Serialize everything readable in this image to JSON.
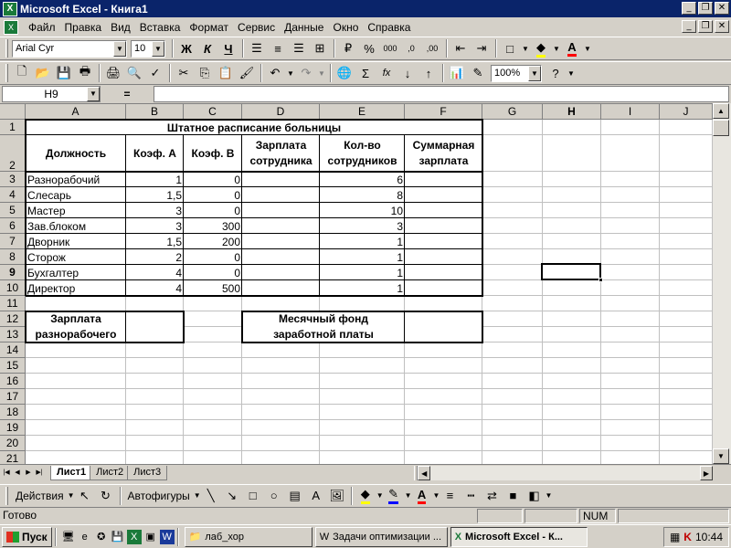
{
  "window": {
    "title": "Microsoft Excel - Книга1",
    "app_icon_letter": "X"
  },
  "menu": [
    "Файл",
    "Правка",
    "Вид",
    "Вставка",
    "Формат",
    "Сервис",
    "Данные",
    "Окно",
    "Справка"
  ],
  "format_toolbar": {
    "font": "Arial Cyr",
    "size": "10",
    "bold": "Ж",
    "italic": "К",
    "underline": "Ч",
    "percent": "%",
    "thousands": "000"
  },
  "standard_toolbar": {
    "zoom": "100%",
    "autosum": "Σ",
    "function": "fx"
  },
  "formula_bar": {
    "name_box": "H9",
    "equals": "="
  },
  "columns": [
    "A",
    "B",
    "C",
    "D",
    "E",
    "F",
    "G",
    "H",
    "I",
    "J"
  ],
  "selected_column": "H",
  "selected_row": "9",
  "rows": [
    "1",
    "2",
    "3",
    "4",
    "5",
    "6",
    "7",
    "8",
    "9",
    "10",
    "11",
    "12",
    "13",
    "14",
    "15",
    "16",
    "17",
    "18",
    "19",
    "20",
    "21"
  ],
  "sheet": {
    "title": "Штатное расписание больницы",
    "headers": {
      "a": "Должность",
      "b": "Коэф. А",
      "c": "Коэф. В",
      "d1": "Зарплата",
      "d2": "сотрудника",
      "e1": "Кол-во",
      "e2": "сотрудников",
      "f1": "Суммарная",
      "f2": "зарплата"
    },
    "data": [
      {
        "pos": "Разнорабочий",
        "a": "1",
        "b": "0",
        "count": "6"
      },
      {
        "pos": "Слесарь",
        "a": "1,5",
        "b": "0",
        "count": "8"
      },
      {
        "pos": "Мастер",
        "a": "3",
        "b": "0",
        "count": "10"
      },
      {
        "pos": "Зав.блоком",
        "a": "3",
        "b": "300",
        "count": "3"
      },
      {
        "pos": "Дворник",
        "a": "1,5",
        "b": "200",
        "count": "1"
      },
      {
        "pos": "Сторож",
        "a": "2",
        "b": "0",
        "count": "1"
      },
      {
        "pos": "Бухгалтер",
        "a": "4",
        "b": "0",
        "count": "1"
      },
      {
        "pos": "Директор",
        "a": "4",
        "b": "500",
        "count": "1"
      }
    ],
    "box1": {
      "l1": "Зарплата",
      "l2": "разнорабочего"
    },
    "box2": {
      "l1": "Месячный фонд",
      "l2": "заработной платы"
    }
  },
  "sheet_tabs": [
    "Лист1",
    "Лист2",
    "Лист3"
  ],
  "draw_toolbar": {
    "actions": "Действия",
    "autoshapes": "Автофигуры"
  },
  "status": {
    "text": "Готово",
    "num": "NUM"
  },
  "taskbar": {
    "start": "Пуск",
    "buttons": [
      "лаб_хор",
      "Задачи оптимизации ...",
      "Microsoft Excel - К..."
    ],
    "clock": "10:44"
  },
  "colors": {
    "title_bg": "#0a246a",
    "excel_green": "#1a7a3a"
  }
}
